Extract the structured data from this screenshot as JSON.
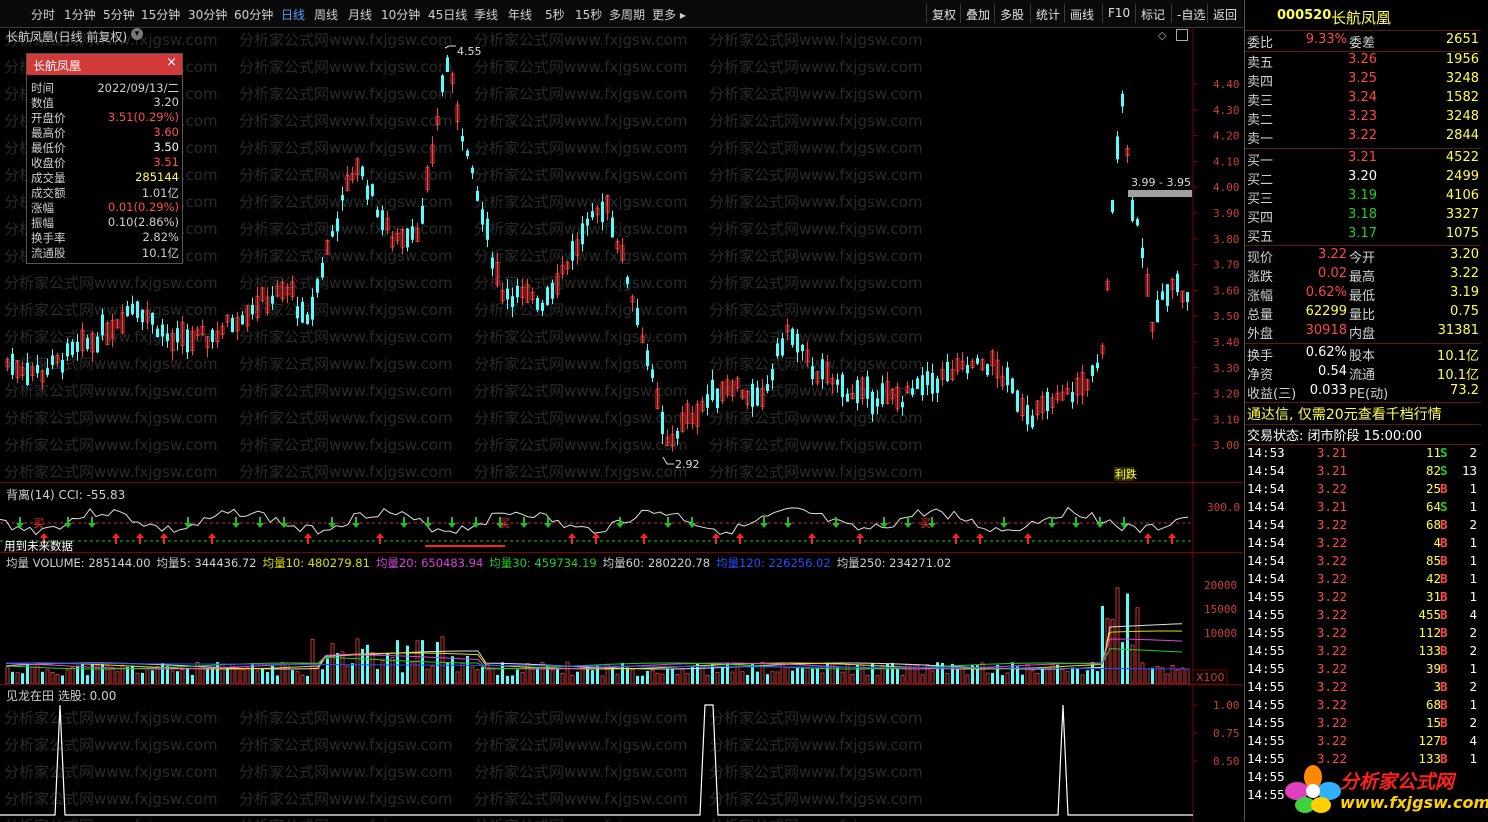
{
  "menu": {
    "periods": [
      "分时",
      "1分钟",
      "5分钟",
      "15分钟",
      "30分钟",
      "60分钟",
      "日线",
      "周线",
      "月线",
      "10分钟",
      "45日线",
      "季线",
      "年线",
      "5秒",
      "15秒",
      "多周期",
      "更多 ▸"
    ],
    "active": "日线",
    "right_buttons": [
      "复权",
      "叠加",
      "多股",
      "统计",
      "画线",
      "F10",
      "标记",
      "-自选",
      "返回"
    ]
  },
  "main_chart": {
    "title": "长航凤凰(日线 前复权)",
    "high_label": "4.55",
    "low_label": "2.92",
    "range_label": "3.99 - 3.95",
    "tag": "利跌",
    "y_ticks": [
      "4.40",
      "4.30",
      "4.20",
      "4.10",
      "4.00",
      "3.90",
      "3.80",
      "3.70",
      "3.60",
      "3.50",
      "3.40",
      "3.30",
      "3.20",
      "3.10",
      "3.00"
    ],
    "watermark": "分析家公式网www.fxjgsw.com"
  },
  "info_box": {
    "title": "长航凤凰",
    "rows": [
      {
        "label": "时间",
        "value": "2022/09/13/二",
        "color": "#d0d0d0"
      },
      {
        "label": "数值",
        "value": "3.20",
        "color": "#d0d0d0"
      },
      {
        "label": "开盘价",
        "value": "3.51(0.29%)",
        "color": "#ff5050"
      },
      {
        "label": "最高价",
        "value": "3.60",
        "color": "#ff5050"
      },
      {
        "label": "最低价",
        "value": "3.50",
        "color": "#ffffff"
      },
      {
        "label": "收盘价",
        "value": "3.51",
        "color": "#ff5050"
      },
      {
        "label": "成交量",
        "value": "285144",
        "color": "#ffff50"
      },
      {
        "label": "成交额",
        "value": "1.01亿",
        "color": "#d0d0d0"
      },
      {
        "label": "涨幅",
        "value": "0.01(0.29%)",
        "color": "#ff5050"
      },
      {
        "label": "振幅",
        "value": "0.10(2.86%)",
        "color": "#d0d0d0"
      },
      {
        "label": "换手率",
        "value": "2.82%",
        "color": "#d0d0d0"
      },
      {
        "label": "流通股",
        "value": "10.1亿",
        "color": "#d0d0d0"
      }
    ]
  },
  "cci_pane": {
    "title": "背离(14)  CCI: -55.83",
    "y_tick": "300.0",
    "note": "用到未来数据",
    "buy_label": "买"
  },
  "volume_pane": {
    "items": [
      {
        "text": "均量 VOLUME: 285144.00",
        "color": "#d0d0d0"
      },
      {
        "text": "均量5: 344436.72",
        "color": "#d0d0d0"
      },
      {
        "text": "均量10: 480279.81",
        "color": "#e0e000"
      },
      {
        "text": "均量20: 650483.94",
        "color": "#e040e0"
      },
      {
        "text": "均量30: 459734.19",
        "color": "#20d020"
      },
      {
        "text": "均量60: 280220.78",
        "color": "#d0d0d0"
      },
      {
        "text": "均量120: 226256.02",
        "color": "#2050ff"
      },
      {
        "text": "均量250: 234271.02",
        "color": "#d0d0d0"
      }
    ],
    "y_ticks": [
      "20000",
      "15000",
      "10000"
    ],
    "unit": "X100"
  },
  "signal_pane": {
    "title": "见龙在田  选股: 0.00",
    "y_ticks": [
      "1.00",
      "0.75",
      "0.50"
    ]
  },
  "quote": {
    "code": "000520",
    "name": "长航凤凰",
    "webi": {
      "l1": "委比",
      "v1": "9.33%",
      "l2": "委差",
      "v2": "2651"
    },
    "sells": [
      {
        "l": "卖五",
        "p": "3.26",
        "v": "1956"
      },
      {
        "l": "卖四",
        "p": "3.25",
        "v": "3248"
      },
      {
        "l": "卖三",
        "p": "3.24",
        "v": "1582"
      },
      {
        "l": "卖二",
        "p": "3.23",
        "v": "3248"
      },
      {
        "l": "卖一",
        "p": "3.22",
        "v": "2844"
      }
    ],
    "buys": [
      {
        "l": "买一",
        "p": "3.21",
        "v": "4522",
        "c": "red"
      },
      {
        "l": "买二",
        "p": "3.20",
        "v": "2499",
        "c": "white"
      },
      {
        "l": "买三",
        "p": "3.19",
        "v": "4106",
        "c": "green"
      },
      {
        "l": "买四",
        "p": "3.18",
        "v": "3327",
        "c": "green"
      },
      {
        "l": "买五",
        "p": "3.17",
        "v": "1075",
        "c": "green"
      }
    ],
    "stats": [
      {
        "l1": "现价",
        "v1": "3.22",
        "c1": "red",
        "l2": "今开",
        "v2": "3.20",
        "c2": "white"
      },
      {
        "l1": "涨跌",
        "v1": "0.02",
        "c1": "red",
        "l2": "最高",
        "v2": "3.22",
        "c2": "red"
      },
      {
        "l1": "涨幅",
        "v1": "0.62%",
        "c1": "red",
        "l2": "最低",
        "v2": "3.19",
        "c2": "green"
      },
      {
        "l1": "总量",
        "v1": "62299",
        "c1": "yellow",
        "l2": "量比",
        "v2": "0.75",
        "c2": "yellow"
      },
      {
        "l1": "外盘",
        "v1": "30918",
        "c1": "red",
        "l2": "内盘",
        "v2": "31381",
        "c2": "green"
      }
    ],
    "stats2": [
      {
        "l1": "换手",
        "v1": "0.62%",
        "l2": "股本",
        "v2": "10.1亿"
      },
      {
        "l1": "净资",
        "v1": "0.54",
        "l2": "流通",
        "v2": "10.1亿"
      },
      {
        "l1": "收益(三)",
        "v1": "0.033",
        "l2": "PE(动)",
        "v2": "73.2"
      }
    ],
    "promo": "通达信, 仅需20元查看千档行情",
    "trade_status": "交易状态: 闭市阶段 15:00:00",
    "ticks": [
      {
        "t": "14:53",
        "p": "3.21",
        "v": "11",
        "s": "S",
        "n": "2"
      },
      {
        "t": "14:54",
        "p": "3.21",
        "v": "82",
        "s": "S",
        "n": "13"
      },
      {
        "t": "14:54",
        "p": "3.22",
        "v": "25",
        "s": "B",
        "n": "1"
      },
      {
        "t": "14:54",
        "p": "3.21",
        "v": "64",
        "s": "S",
        "n": "1"
      },
      {
        "t": "14:54",
        "p": "3.22",
        "v": "68",
        "s": "B",
        "n": "2"
      },
      {
        "t": "14:54",
        "p": "3.22",
        "v": "4",
        "s": "B",
        "n": "1"
      },
      {
        "t": "14:54",
        "p": "3.22",
        "v": "85",
        "s": "B",
        "n": "1"
      },
      {
        "t": "14:54",
        "p": "3.22",
        "v": "42",
        "s": "B",
        "n": "1"
      },
      {
        "t": "14:55",
        "p": "3.22",
        "v": "31",
        "s": "B",
        "n": "1"
      },
      {
        "t": "14:55",
        "p": "3.22",
        "v": "455",
        "s": "B",
        "n": "4"
      },
      {
        "t": "14:55",
        "p": "3.22",
        "v": "112",
        "s": "B",
        "n": "2"
      },
      {
        "t": "14:55",
        "p": "3.22",
        "v": "133",
        "s": "B",
        "n": "2"
      },
      {
        "t": "14:55",
        "p": "3.22",
        "v": "39",
        "s": "B",
        "n": "1"
      },
      {
        "t": "14:55",
        "p": "3.22",
        "v": "3",
        "s": "B",
        "n": "2"
      },
      {
        "t": "14:55",
        "p": "3.22",
        "v": "68",
        "s": "B",
        "n": "1"
      },
      {
        "t": "14:55",
        "p": "3.22",
        "v": "15",
        "s": "B",
        "n": "2"
      },
      {
        "t": "14:55",
        "p": "3.22",
        "v": "127",
        "s": "B",
        "n": "4"
      },
      {
        "t": "14:55",
        "p": "3.22",
        "v": "133",
        "s": "B",
        "n": "1"
      },
      {
        "t": "14:55",
        "p": "",
        "v": "",
        "s": "",
        "n": ""
      },
      {
        "t": "14:55",
        "p": "",
        "v": "",
        "s": "",
        "n": ""
      }
    ],
    "logo_title": "分析家公式网",
    "logo_url": "www.fxjgsw.com"
  }
}
